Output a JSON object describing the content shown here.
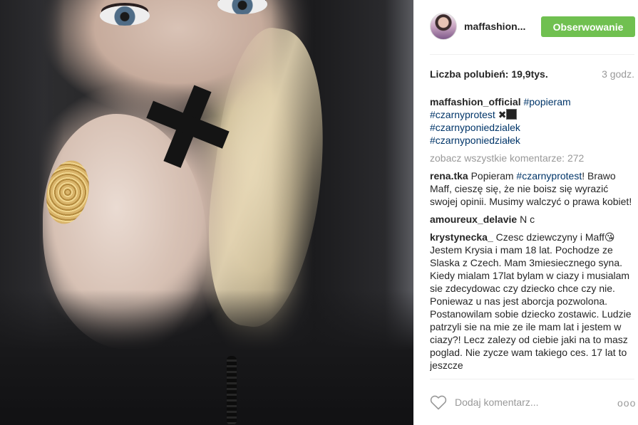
{
  "post": {
    "author": "maffashion...",
    "follow_label": "Obserwowanie",
    "likes": "Liczba polubień: 19,9tys.",
    "time": "3 godz."
  },
  "caption": {
    "user": "maffashion_official",
    "tags": [
      "#popieram",
      "#czarnyprotest",
      "#czarnyponiedzialek",
      "#czarnyponiedziałek"
    ],
    "emoji": "✖",
    "view_all": "zobacz wszystkie komentarze: 272"
  },
  "comments": [
    {
      "user": "rena.tka",
      "pre": "Popieram ",
      "tag": "#czarnyprotest",
      "post": "! Brawo Maff, cieszę się, że nie boisz się wyrazić swojej opinii. Musimy walczyć o prawa kobiet!"
    },
    {
      "user": "amoureux_delavie",
      "text": "N c"
    },
    {
      "user": "krystynecka_",
      "text": "Czesc dziewczyny i Maff😘 Jestem Krysia i mam 18 lat. Pochodze ze Slaska z Czech. Mam 3miesiecznego syna. Kiedy mialam 17lat bylam w ciazy i musialam sie zdecydowac czy dziecko chce czy nie. Poniewaz u nas jest aborcja pozwolona. Postanowilam sobie dziecko zostawic. Ludzie patrzyli sie na mie ze ile mam lat i jestem w ciazy?! Lecz zalezy od ciebie jaki na to masz poglad. Nie zycze wam takiego ces. 17 lat to jeszcze"
    }
  ],
  "footer": {
    "comment_placeholder": "Dodaj komentarz...",
    "more_label": "ooo"
  },
  "colors": {
    "follow_button": "#70c050",
    "hashtag": "#003569",
    "muted": "#999999"
  }
}
